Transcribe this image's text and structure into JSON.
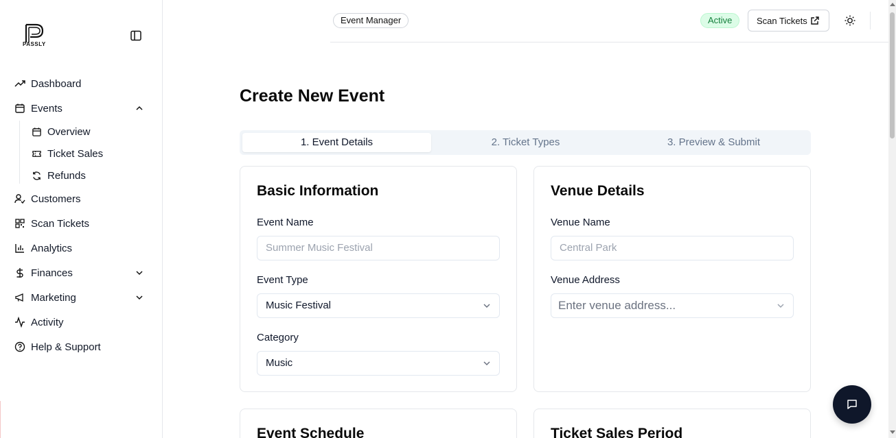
{
  "brand": {
    "logo_text": "PASSLY"
  },
  "sidebar": {
    "items": [
      {
        "label": "Dashboard",
        "icon": "trending-up-icon"
      },
      {
        "label": "Events",
        "icon": "calendar-icon"
      },
      {
        "label": "Customers",
        "icon": "user-check-icon"
      },
      {
        "label": "Scan Tickets",
        "icon": "qr-code-icon"
      },
      {
        "label": "Analytics",
        "icon": "bar-chart-icon"
      },
      {
        "label": "Finances",
        "icon": "dollar-icon"
      },
      {
        "label": "Marketing",
        "icon": "megaphone-icon"
      },
      {
        "label": "Activity",
        "icon": "activity-icon"
      },
      {
        "label": "Help & Support",
        "icon": "help-circle-icon"
      }
    ],
    "events_sub": [
      {
        "label": "Overview",
        "icon": "calendar-icon"
      },
      {
        "label": "Ticket Sales",
        "icon": "ticket-icon"
      },
      {
        "label": "Refunds",
        "icon": "refresh-icon"
      }
    ]
  },
  "header": {
    "role": "Event Manager",
    "status": "Active",
    "scan_button": "Scan Tickets"
  },
  "main": {
    "title": "Create New Event",
    "tabs": [
      {
        "label": "1. Event Details",
        "active": true
      },
      {
        "label": "2. Ticket Types",
        "active": false
      },
      {
        "label": "3. Preview & Submit",
        "active": false
      }
    ],
    "basic": {
      "title": "Basic Information",
      "event_name_label": "Event Name",
      "event_name_placeholder": "Summer Music Festival",
      "event_type_label": "Event Type",
      "event_type_value": "Music Festival",
      "category_label": "Category",
      "category_value": "Music"
    },
    "venue": {
      "title": "Venue Details",
      "venue_name_label": "Venue Name",
      "venue_name_placeholder": "Central Park",
      "venue_address_label": "Venue Address",
      "venue_address_placeholder": "Enter venue address..."
    },
    "schedule": {
      "title": "Event Schedule"
    },
    "sales_period": {
      "title": "Ticket Sales Period"
    }
  },
  "colors": {
    "accent_dark": "#0f172a",
    "status_green_bg": "#dcfce7",
    "status_green_text": "#15803d"
  }
}
